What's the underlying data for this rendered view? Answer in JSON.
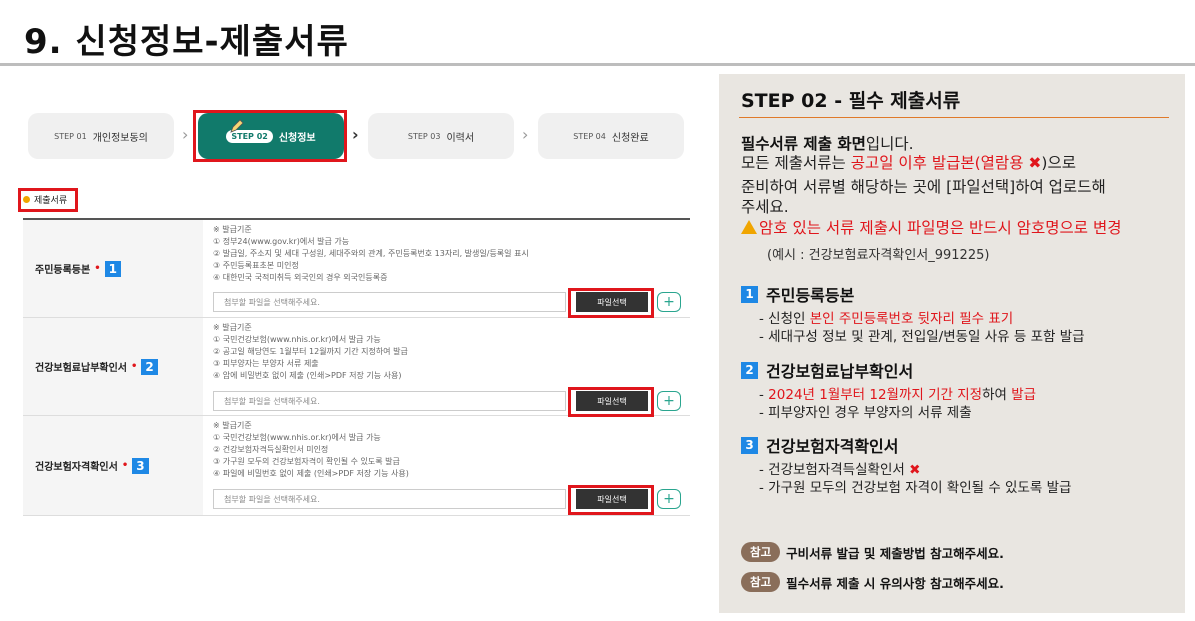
{
  "page_title": "9. 신청정보-제출서류",
  "steps": [
    {
      "num": "STEP 01",
      "label": "개인정보동의"
    },
    {
      "num": "STEP 02",
      "label": "신청정보"
    },
    {
      "num": "STEP 03",
      "label": "이력서"
    },
    {
      "num": "STEP 04",
      "label": "신청완료"
    }
  ],
  "section_label": "제출서류",
  "rows": [
    {
      "label": "주민등록등본",
      "badge": "1",
      "guide": [
        "※ 발급기준",
        "① 정부24(www.gov.kr)에서 발급 가능",
        "② 발급일, 주소지 및 세대 구성원, 세대주와의 관계, 주민등록번호 13자리, 발생일/등록일 표시",
        "③ 주민등록표초본 미인정",
        "④ 대한민국 국적미취득 외국인의 경우 외국인등록증"
      ],
      "placeholder": "첨부할 파일을 선택해주세요.",
      "button": "파일선택",
      "plus": "+"
    },
    {
      "label": "건강보험료납부확인서",
      "badge": "2",
      "guide": [
        "※ 발급기준",
        "① 국민건강보험(www.nhis.or.kr)에서 발급 가능",
        "② 공고일 해당연도 1월부터 12월까지 기간 지정하여 발급",
        "③ 피부양자는 부양자 서류 제출",
        "④ 암에 비밀번호 없이 제출 (인쇄>PDF 저장 기능 사용)"
      ],
      "placeholder": "첨부할 파일을 선택해주세요.",
      "button": "파일선택",
      "plus": "+"
    },
    {
      "label": "건강보험자격확인서",
      "badge": "3",
      "guide": [
        "※ 발급기준",
        "① 국민건강보험(www.nhis.or.kr)에서 발급 가능",
        "② 건강보험자격득실확인서 미인정",
        "③ 가구원 모두의 건강보험자격이 확인될 수 있도록 발급",
        "④ 파일에 비밀번호 없이 제출 (인쇄>PDF 저장 기능 사용)"
      ],
      "placeholder": "첨부할 파일을 선택해주세요.",
      "button": "파일선택",
      "plus": "+"
    }
  ],
  "info": {
    "title": "STEP 02 - 필수 제출서류",
    "intro_bold": "필수서류 제출 화면",
    "intro_rest": "입니다.",
    "line2_a": "모든 제출서류는 ",
    "line2_red": "공고일 이후 발급본(열람용 ",
    "line2_x": "✖",
    "line2_b": ")으로",
    "line3": "준비하여 서류별 해당하는 곳에 [파일선택]하여 업로드해",
    "line4": "주세요.",
    "warning": "암호 있는 서류 제출시 파일명은 반드시 암호명으로 변경",
    "example": "(예시 : 건강보험료자격확인서_991225)",
    "items": [
      {
        "badge": "1",
        "title": "주민등록등본",
        "l1_a": "- 신청인 ",
        "l1_red": "본인 주민등록번호 뒷자리 필수 표기",
        "l2": "- 세대구성 정보 및 관계, 전입일/변동일 사유 등 포함 발급"
      },
      {
        "badge": "2",
        "title": "건강보험료납부확인서",
        "l1_a": "- ",
        "l1_red": "2024년 1월부터 12월까지 기간 지정",
        "l1_b": "하여 ",
        "l1_red2": "발급",
        "l2": "- 피부양자인 경우 부양자의 서류 제출"
      },
      {
        "badge": "3",
        "title": "건강보험자격확인서",
        "l1_a": "- 건강보험자격득실확인서 ",
        "l1_x": "✖",
        "l2": "- 가구원 모두의 건강보험 자격이 확인될 수 있도록 발급"
      }
    ],
    "refs": [
      {
        "tag": "참고",
        "text": "구비서류 발급 및 제출방법 참고해주세요."
      },
      {
        "tag": "참고",
        "text": "필수서류 제출 시 유의사항 참고해주세요."
      }
    ]
  },
  "colors": {
    "accent": "#117a6b",
    "highlight": "#e0161c",
    "badge": "#1e88e5",
    "panel": "#e9e6e1"
  }
}
